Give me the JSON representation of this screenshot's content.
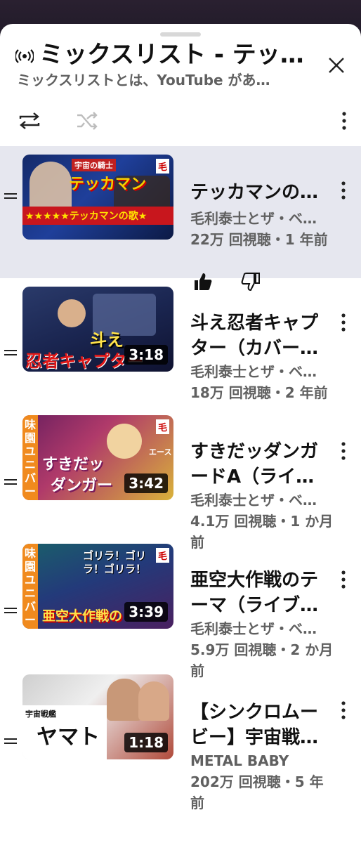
{
  "header": {
    "title": "ミックスリスト - テッ…",
    "subtitle": "ミックスリストとは、YouTube があ…"
  },
  "icons": {
    "live": "broadcast-icon",
    "close": "close-icon",
    "loop": "loop-icon",
    "shuffle": "shuffle-icon",
    "menu": "more-vert-icon"
  },
  "colors": {
    "active_row": "#e6e7ef",
    "secondary_text": "#606060",
    "shuffle_disabled": "#bdbdbd"
  },
  "items": [
    {
      "title": "テッカマンの…",
      "channel": "毛利泰士とザ・ベ…",
      "meta": "22万 回視聴・1 年前",
      "duration": "",
      "active": true,
      "thumb_text_1": "宇宙の騎士",
      "thumb_text_2": "テッカマン",
      "thumb_text_3": "★★★★★テッカマンの歌★",
      "badge": "毛"
    },
    {
      "title": "斗え忍者キャプター（カバー…",
      "channel": "毛利泰士とザ・ベ…",
      "meta": "18万 回視聴・2 年前",
      "duration": "3:18",
      "thumb_text_1": "斗え",
      "thumb_text_2": "忍者キャプター"
    },
    {
      "title": "すきだッダンガードA（ライ…",
      "channel": "毛利泰士とザ・ベ…",
      "meta": "4.1万 回視聴・1 か月前",
      "duration": "3:42",
      "thumb_text_1": "味園ユニバース",
      "thumb_text_2": "すきだッ",
      "thumb_text_3": "ダンガー",
      "thumb_text_4": "エース",
      "badge": "毛"
    },
    {
      "title": "亜空大作戦のテーマ（ライブ…",
      "channel": "毛利泰士とザ・ベ…",
      "meta": "5.9万 回視聴・2 か月前",
      "duration": "3:39",
      "thumb_text_1": "味園ユニバース",
      "thumb_text_2": "ゴリラ！ゴリラ！ゴリラ！",
      "thumb_text_3": "亜空大作戦の",
      "badge": "毛"
    },
    {
      "title": "【シンクロムービー】宇宙戦…",
      "channel": "METAL BABY",
      "meta": "202万 回視聴・5 年前",
      "duration": "1:18",
      "thumb_text_1": "宇宙戦艦",
      "thumb_text_2": "ヤマト"
    }
  ]
}
